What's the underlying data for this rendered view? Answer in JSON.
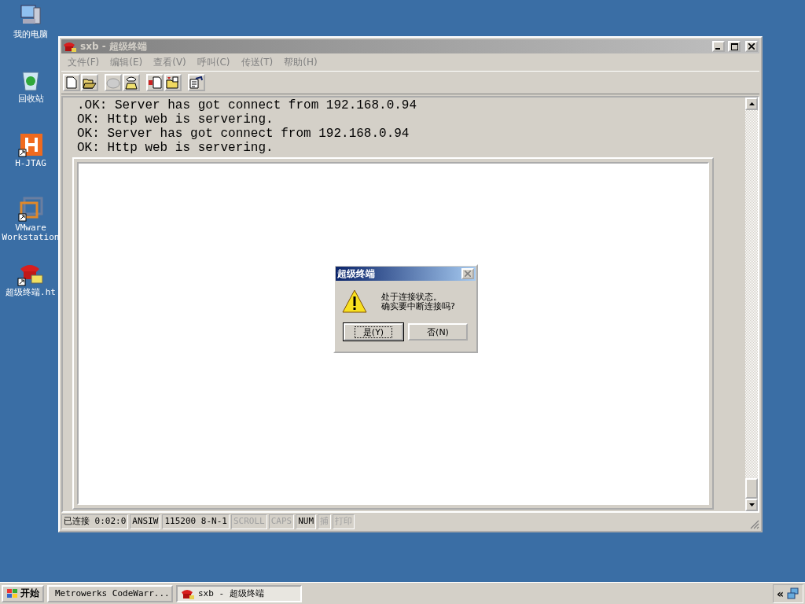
{
  "desktop_icons": [
    {
      "kind": "computer",
      "label": "我的电脑"
    },
    {
      "kind": "recycle",
      "label": "回收站"
    },
    {
      "kind": "hjtag",
      "label": "H-JTAG"
    },
    {
      "kind": "vmware",
      "label": "VMware Workstation"
    },
    {
      "kind": "phone",
      "label": "超级终端.ht"
    }
  ],
  "window": {
    "title": "sxb - 超级终端",
    "active": false,
    "menu": [
      "文件(F)",
      "编辑(E)",
      "查看(V)",
      "呼叫(C)",
      "传送(T)",
      "帮助(H)"
    ],
    "toolbar": [
      [
        {
          "kind": "new",
          "disabled": false
        },
        {
          "kind": "open",
          "disabled": false
        }
      ],
      [
        {
          "kind": "disconnect",
          "disabled": true
        },
        {
          "kind": "dial",
          "disabled": false
        }
      ],
      [
        {
          "kind": "send",
          "disabled": false
        },
        {
          "kind": "receive",
          "disabled": false
        }
      ],
      [
        {
          "kind": "properties",
          "disabled": false
        }
      ]
    ],
    "terminal_lines": [
      ".OK: Server has got connect from 192.168.0.94",
      "OK: Http web is servering.",
      "OK: Server has got connect from 192.168.0.94",
      "OK: Http web is servering."
    ],
    "status_bar": [
      {
        "text": "已连接 0:02:0",
        "disabled": false
      },
      {
        "text": "ANSIW",
        "disabled": false
      },
      {
        "text": "115200 8-N-1",
        "disabled": false
      },
      {
        "text": "SCROLL",
        "disabled": true
      },
      {
        "text": "CAPS",
        "disabled": true
      },
      {
        "text": "NUM",
        "disabled": false
      },
      {
        "text": "捕",
        "disabled": true
      },
      {
        "text": "打印",
        "disabled": true
      }
    ]
  },
  "dialog": {
    "title": "超级终端",
    "active": true,
    "message_lines": [
      "处于连接状态。",
      "确实要中断连接吗?"
    ],
    "buttons": [
      {
        "label": "是(Y)",
        "selected": true
      },
      {
        "label": "否(N)",
        "selected": false
      }
    ]
  },
  "taskbar": {
    "start": "开始",
    "tasks": [
      {
        "kind": "codewarrior",
        "label": "Metrowerks CodeWarr...",
        "selected": false
      },
      {
        "kind": "phone",
        "label": "sxb - 超级终端",
        "selected": true
      }
    ],
    "tray_toggle": "«"
  }
}
